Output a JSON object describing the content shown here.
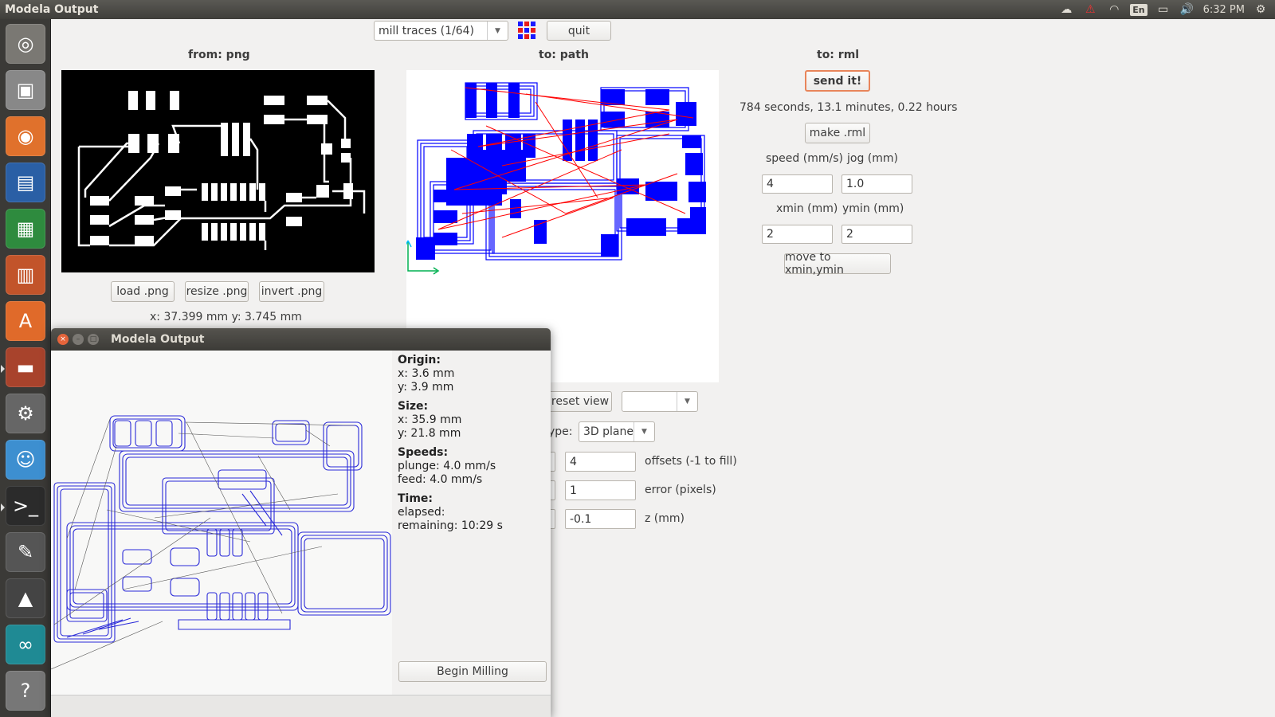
{
  "window": {
    "title": "Modela Output"
  },
  "tray": {
    "clock": "6:32 PM",
    "lang": "En"
  },
  "toolbar": {
    "mode_select": "mill traces (1/64)",
    "quit_label": "quit"
  },
  "columns": {
    "from": "from: png",
    "to_path": "to: path",
    "to_rml": "to: rml"
  },
  "png": {
    "load": "load .png",
    "resize": "resize .png",
    "invert": "invert .png",
    "coords": "x: 37.399 mm  y: 3.745 mm"
  },
  "rml": {
    "send_label": "send it!",
    "time_estimate": "784 seconds, 13.1 minutes, 0.22 hours",
    "make_label": "make .rml",
    "speed_label": "speed (mm/s)",
    "jog_label": "jog (mm)",
    "speed_value": "4",
    "jog_value": "1.0",
    "xmin_label": "xmin (mm)",
    "ymin_label": "ymin (mm)",
    "xmin_value": "2",
    "ymin_value": "2",
    "move_label": "move to xmin,ymin"
  },
  "path": {
    "reset_view": "reset view",
    "type_label": "ype:",
    "type_value": "3D plane",
    "offsets_value": "4",
    "offsets_label": "offsets (-1 to fill)",
    "error_value": "1",
    "error_label": "error (pixels)",
    "z_value": "-0.1",
    "z_label": "z (mm)"
  },
  "dialog": {
    "title": "Modela Output",
    "origin_h": "Origin:",
    "origin_x": "x: 3.6 mm",
    "origin_y": "y: 3.9 mm",
    "size_h": "Size:",
    "size_x": "x: 35.9 mm",
    "size_y": "y: 21.8 mm",
    "speeds_h": "Speeds:",
    "plunge": "plunge: 4.0 mm/s",
    "feed": "feed: 4.0 mm/s",
    "time_h": "Time:",
    "elapsed": "elapsed:",
    "remaining": "remaining: 10:29 s",
    "begin_label": "Begin Milling"
  },
  "colors": {
    "accent": "#e8855a",
    "path_blue": "#0000ff",
    "path_red": "#ff0000",
    "launcher": "#3b3a37"
  }
}
